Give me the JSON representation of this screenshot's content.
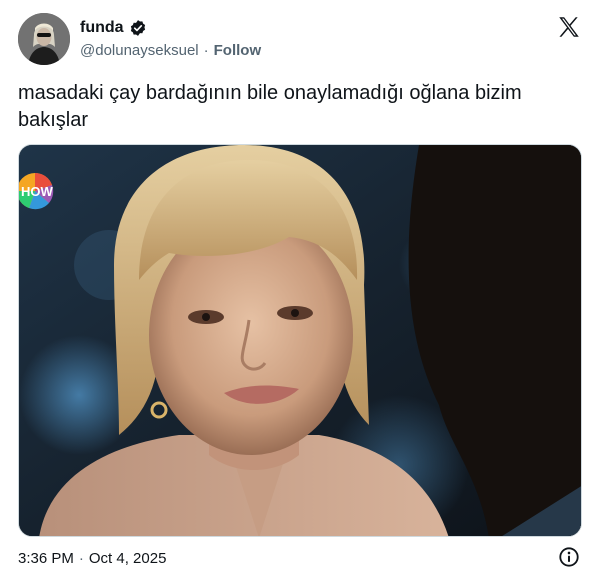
{
  "author": {
    "display_name": "funda",
    "handle": "@dolunayseksuel",
    "follow_label": "Follow",
    "separator": "·",
    "verified": true
  },
  "tweet": {
    "text": "masadaki çay bardağının bile onaylamadığı oğlana bizim bakışlar",
    "time": "3:36 PM",
    "separator": "·",
    "date": "Oct 4, 2025"
  },
  "media": {
    "watermark": "HOW",
    "description_icon": "tv-channel-logo"
  },
  "icons": {
    "verified": "verified-badge-icon",
    "brand": "x-logo-icon",
    "info": "info-icon"
  },
  "colors": {
    "text_primary": "#0f1419",
    "text_secondary": "#536471",
    "border": "#cfd9de"
  }
}
